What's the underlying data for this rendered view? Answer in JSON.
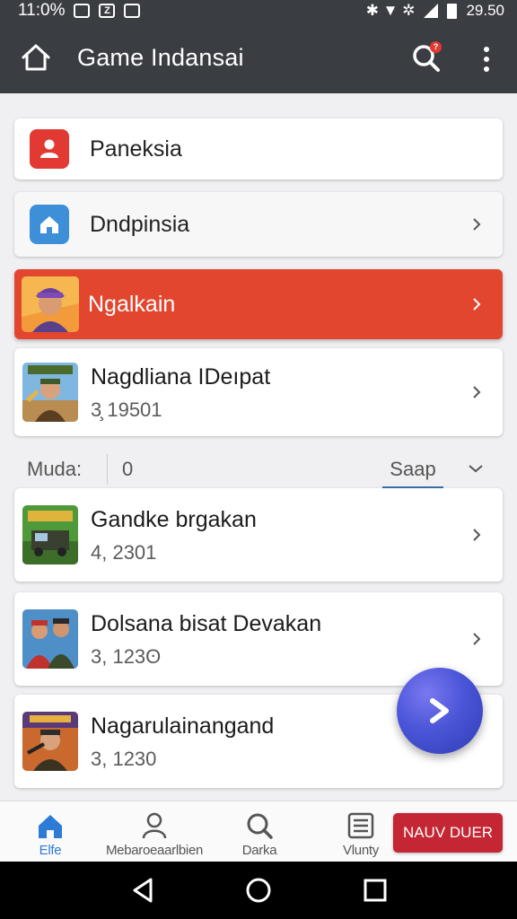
{
  "status_bar": {
    "time": "11:0%",
    "icon_box_1": "",
    "icon_box_2": "Z",
    "icon_box_3": "",
    "right_text": "29.50",
    "right_icons": "✱ ▼ ✲"
  },
  "app_bar": {
    "title": "Game Indansai",
    "search_badge": "?"
  },
  "menu": [
    {
      "label": "Paneksia",
      "icon": "person-icon",
      "color": "#e23a33",
      "chevron": false
    },
    {
      "label": "Dndpinsia",
      "icon": "home-icon",
      "color": "#3d8fd8",
      "chevron": true
    }
  ],
  "featured": {
    "label": "Ngalkain",
    "background": "#e3462f"
  },
  "top_game": {
    "title": "Nagdliana IDeıpat",
    "meta": "3̧ 19501"
  },
  "filter": {
    "label": "Muda:",
    "value": "0",
    "sort_label": "Saap"
  },
  "games": [
    {
      "title": "Gandke brgakan",
      "meta": "4, 2301",
      "icon": "truck-game-thumbnail"
    },
    {
      "title": "Dolsana bisat Devakan",
      "meta": "3, 123ʘ",
      "icon": "heroes-game-thumbnail"
    },
    {
      "title": "Nagarulainangand",
      "meta": "3, 1230",
      "icon": "soldier-game-thumbnail"
    }
  ],
  "bottom_nav": [
    {
      "label": "Elfe",
      "icon": "home-icon",
      "active": true
    },
    {
      "label": "Mebaroeaarlbien",
      "icon": "person-icon",
      "active": false
    },
    {
      "label": "Darka",
      "icon": "search-icon",
      "active": false
    },
    {
      "label": "Vlunty",
      "icon": "list-icon",
      "active": false
    }
  ],
  "cta_label": "NAUV DUER",
  "colors": {
    "app_bar": "#3a3d42",
    "accent_red": "#e3462f",
    "cta_red": "#c42634",
    "active_blue": "#2e7bd6",
    "fab_blue": "#4a55d8"
  }
}
